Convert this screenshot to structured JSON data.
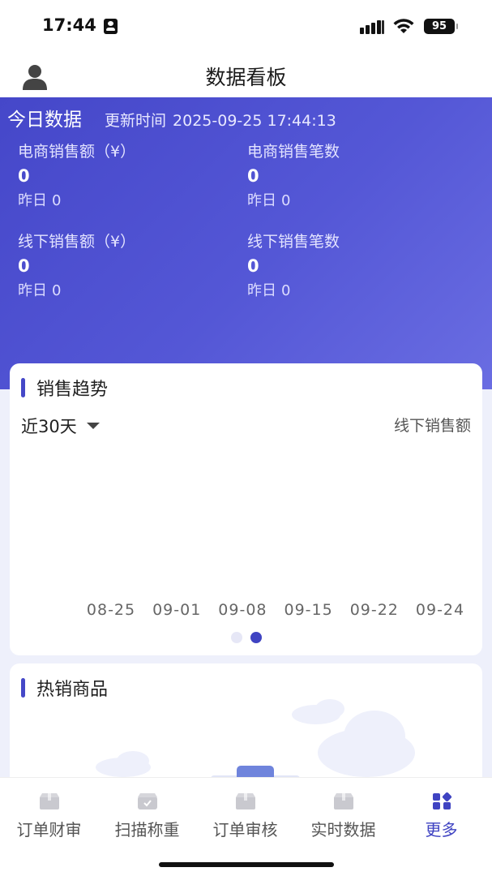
{
  "status_bar": {
    "time": "17:44",
    "battery": "95"
  },
  "nav": {
    "title": "数据看板",
    "avatar_icon": "user-icon"
  },
  "today": {
    "title": "今日数据",
    "update_label": "更新时间",
    "update_time": "2025-09-25 17:44:13",
    "metrics": [
      {
        "label": "电商销售额（¥）",
        "value": "0",
        "yesterday_label": "昨日",
        "yesterday_value": "0"
      },
      {
        "label": "电商销售笔数",
        "value": "0",
        "yesterday_label": "昨日",
        "yesterday_value": "0"
      },
      {
        "label": "线下销售额（¥）",
        "value": "0",
        "yesterday_label": "昨日",
        "yesterday_value": "0"
      },
      {
        "label": "线下销售笔数",
        "value": "0",
        "yesterday_label": "昨日",
        "yesterday_value": "0"
      }
    ]
  },
  "sales_trend": {
    "title": "销售趋势",
    "range": "近30天",
    "metric": "线下销售额",
    "pager": {
      "total": 2,
      "active": 2
    }
  },
  "chart_data": {
    "type": "line",
    "title": "销售趋势",
    "x": [
      "08-25",
      "09-01",
      "09-08",
      "09-15",
      "09-22",
      "09-24"
    ],
    "series": [
      {
        "name": "线下销售额",
        "values": []
      }
    ]
  },
  "hot_products": {
    "title": "热销商品"
  },
  "tabbar": {
    "items": [
      {
        "label": "订单财审",
        "icon": "box-icon"
      },
      {
        "label": "扫描称重",
        "icon": "scale-box-icon"
      },
      {
        "label": "订单审核",
        "icon": "box-icon"
      },
      {
        "label": "实时数据",
        "icon": "box-icon"
      },
      {
        "label": "更多",
        "icon": "grid-more-icon"
      }
    ],
    "active_index": 4
  },
  "colors": {
    "primary": "#3f43c2",
    "hero_start": "#4547c9",
    "hero_end": "#6a6de2",
    "page_bg": "#eef0fb"
  }
}
